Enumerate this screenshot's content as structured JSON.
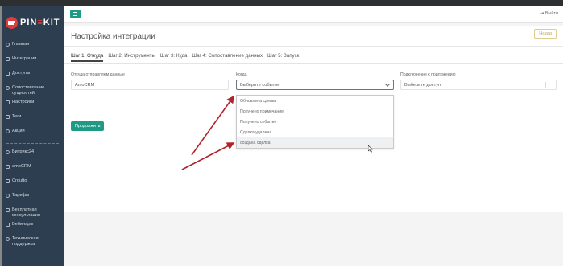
{
  "window": {
    "logout": "Выйти"
  },
  "brand": {
    "logo_lead": "PIN",
    "logo_accent": "≡",
    "logo_tail": "KIT"
  },
  "sidebar": {
    "items_top": [
      {
        "label": "Главная",
        "icon": "home-icon"
      },
      {
        "label": "Интеграции",
        "icon": "puzzle-icon"
      },
      {
        "label": "Доступы",
        "icon": "lock-icon"
      },
      {
        "label": "Сопоставление\nсущностей",
        "icon": "layers-icon"
      },
      {
        "label": "Настройки",
        "icon": "gear-icon"
      },
      {
        "label": "Теги",
        "icon": "tag-icon"
      },
      {
        "label": "Акции",
        "icon": "close-icon"
      }
    ],
    "items_bottom": [
      {
        "label": "Битрикс24",
        "icon": "cloud-icon"
      },
      {
        "label": "amoCRM",
        "icon": "crm-icon"
      },
      {
        "label": "Croutto",
        "icon": "globe-icon"
      },
      {
        "label": "Тарифы",
        "icon": "dollar-icon"
      },
      {
        "label": "Бесплатная\nконсультация",
        "icon": "chat-icon"
      },
      {
        "label": "Вебинары",
        "icon": "video-icon"
      },
      {
        "label": "Техническая\nподдержка",
        "icon": "support-icon"
      }
    ]
  },
  "page": {
    "title": "Настройка интеграции",
    "back_label": "Назад"
  },
  "tabs": [
    {
      "label": "Шаг 1: Откуда",
      "active": true
    },
    {
      "label": "Шаг 2: Инструменты",
      "active": false
    },
    {
      "label": "Шаг 3: Куда",
      "active": false
    },
    {
      "label": "Шаг 4: Сопоставление данных",
      "active": false
    },
    {
      "label": "Шаг 5: Запуск",
      "active": false
    }
  ],
  "form": {
    "source_label": "Откуда отправляем данные",
    "source_value": "AmoCRM",
    "when_label": "Когда",
    "when_value": "Выберите событие",
    "connect_label": "Подключение к приложению",
    "connect_value": "Выберите доступ",
    "submit_label": "Продолжить"
  },
  "dropdown": {
    "options": [
      "Обновлена сделка",
      "Получено примечание",
      "Получено событие",
      "Сделка удалена",
      "создана сделка"
    ],
    "highlighted_index": 4
  },
  "colors": {
    "accent": "#1e9a85",
    "sidebar": "#2c3e50",
    "arrow": "#b3222a"
  }
}
